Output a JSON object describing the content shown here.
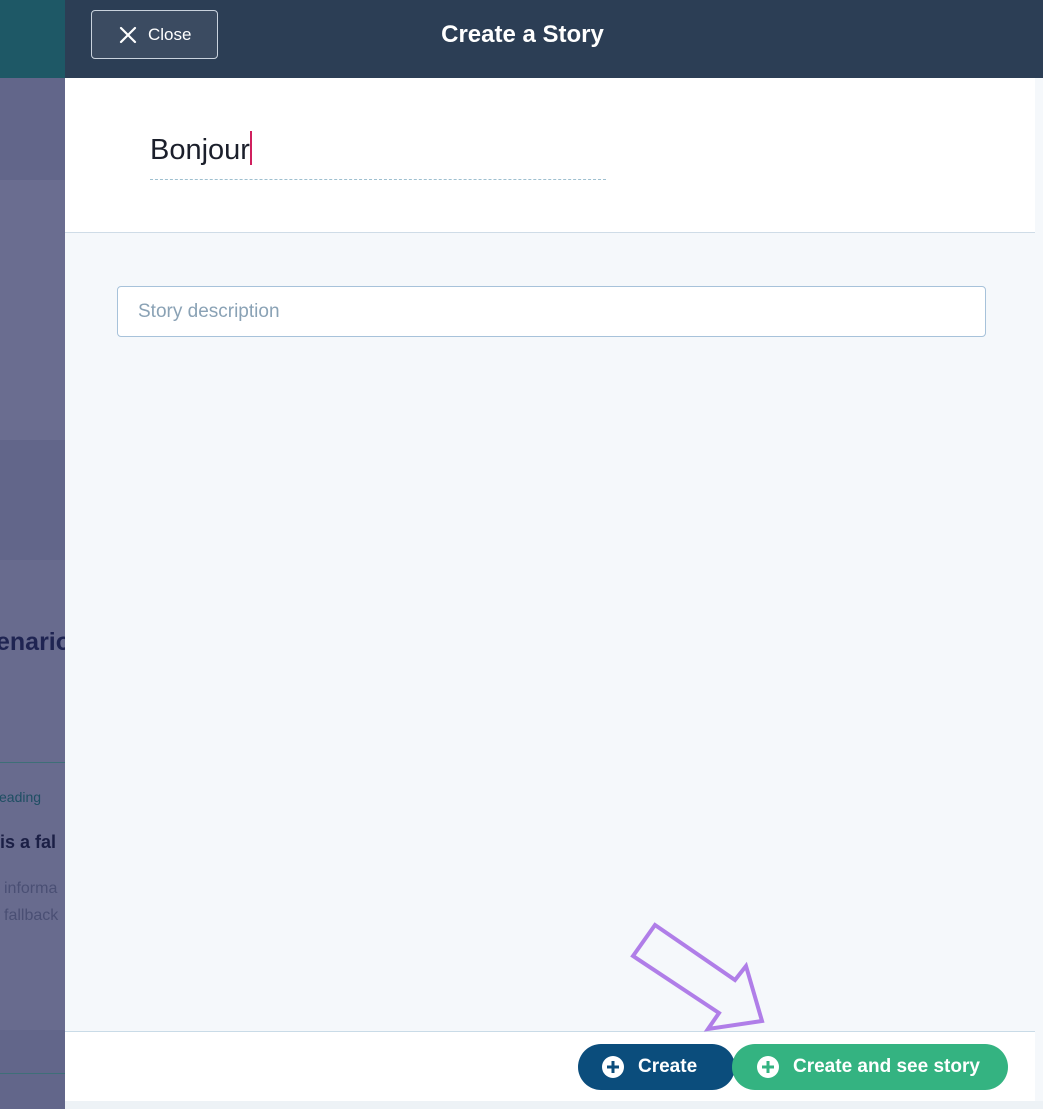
{
  "background": {
    "heading_fragment": "enario",
    "small_label_fragment": "eading",
    "bold_fragment": "is a fal",
    "desc_line1_fragment": "informa",
    "desc_line2_fragment": "fallback"
  },
  "modal": {
    "title": "Create a Story",
    "close_label": "Close",
    "story_title_value": "Bonjour",
    "description_placeholder": "Story description",
    "buttons": {
      "create": "Create",
      "create_and_see": "Create and see story"
    }
  },
  "colors": {
    "header": "#2c3e55",
    "create_button": "#0b4d7c",
    "create_and_see_button": "#34b381",
    "annotation_arrow": "#b07ee8",
    "caret": "#d0205e"
  },
  "icons": {
    "close": "close-icon",
    "plus": "plus-circle-icon",
    "annotation": "arrow-pointer-icon"
  }
}
